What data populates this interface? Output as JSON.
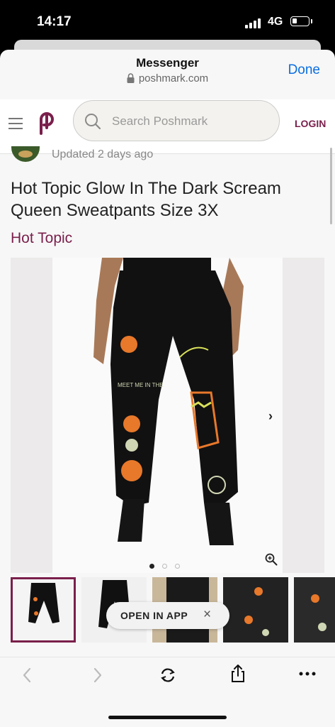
{
  "status_bar": {
    "time": "14:17",
    "network": "4G"
  },
  "browser_header": {
    "title": "Messenger",
    "url": "poshmark.com",
    "done_label": "Done"
  },
  "site_header": {
    "search_placeholder": "Search Poshmark",
    "login_label": "LOGIN"
  },
  "listing": {
    "updated": "Updated 2 days ago",
    "title": "Hot Topic Glow In The Dark Scream Queen Sweatpants Size 3X",
    "brand": "Hot Topic",
    "carousel": {
      "image_count": 3,
      "active_index": 0
    },
    "thumbnail_count": 5,
    "selected_thumbnail": 0
  },
  "open_in_app": {
    "label": "OPEN IN APP"
  },
  "icons": {
    "menu": "hamburger-icon",
    "logo": "poshmark-logo-icon",
    "search": "search-icon",
    "lock": "lock-icon",
    "next": "chevron-right-icon",
    "zoom": "zoom-in-icon",
    "close": "close-icon",
    "back": "chevron-left-icon",
    "forward": "chevron-right-icon",
    "refresh": "refresh-icon",
    "share": "share-icon",
    "more": "more-icon"
  },
  "colors": {
    "brand": "#7a1f4b",
    "link": "#0a6de0"
  }
}
